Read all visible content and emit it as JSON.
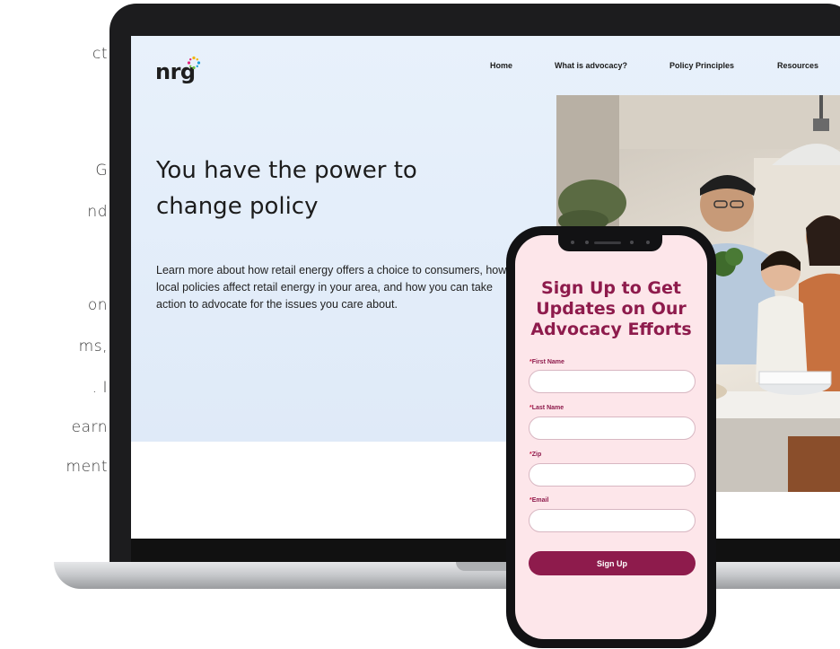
{
  "left_text_fragments": [
    "ct",
    "G",
    "nd",
    "on",
    "ms,",
    ". I",
    "earn",
    "ment"
  ],
  "website": {
    "logo_text": "nrg",
    "nav": [
      "Home",
      "What is advocacy?",
      "Policy Principles",
      "Resources"
    ],
    "hero_title": "You have the power to change policy",
    "hero_body": "Learn more about how retail energy offers a choice to consumers, how local policies affect retail energy in your area, and how you can take action to advocate for the issues you care about."
  },
  "form": {
    "title": "Sign Up to Get Updates on Our Advocacy Efforts",
    "required_marker": "*",
    "fields": [
      {
        "label": "First Name",
        "value": ""
      },
      {
        "label": "Last Name",
        "value": ""
      },
      {
        "label": "Zip",
        "value": ""
      },
      {
        "label": "Email",
        "value": ""
      }
    ],
    "submit_label": "Sign Up"
  },
  "colors": {
    "brand_maroon": "#8e1b4c",
    "hero_bg": "#e3eefa",
    "phone_screen_bg": "#fde6ea",
    "spark_colors": [
      "#f2b400",
      "#e4237a",
      "#1aa0d8",
      "#6cbd45"
    ]
  }
}
